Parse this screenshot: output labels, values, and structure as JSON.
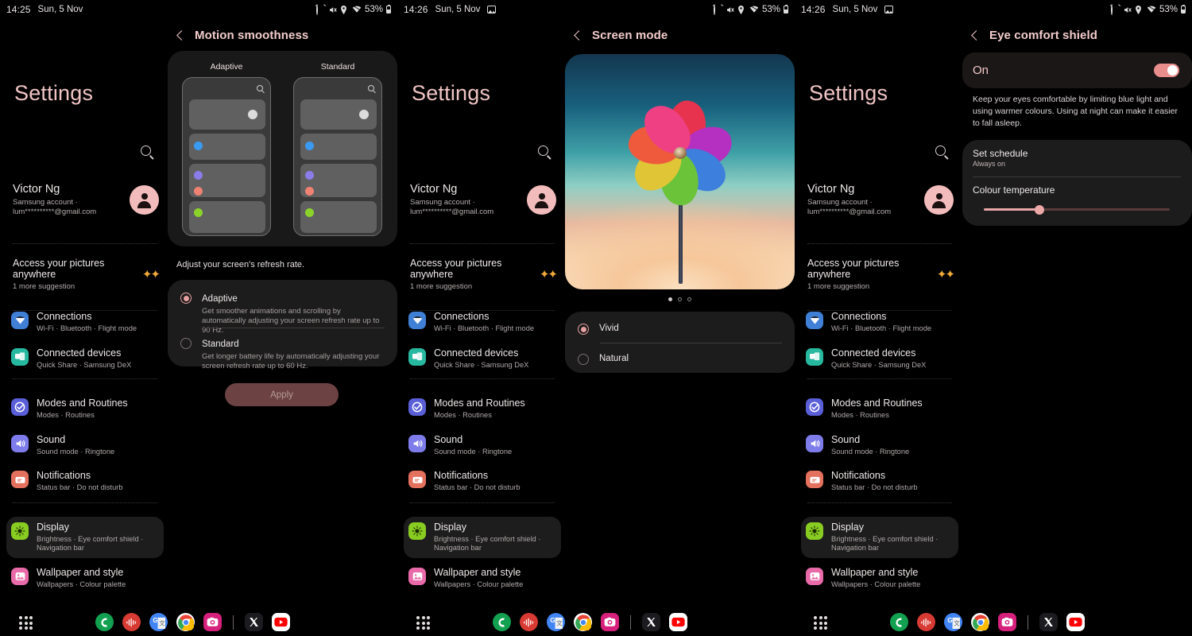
{
  "meta": {
    "accent": "#f0c4c4",
    "selected_row_bg": "#1d1d1d",
    "card_bg": "#1c1c1c"
  },
  "status_bars": [
    {
      "time": "14:25",
      "date": "Sun, 5 Nov",
      "battery": "53%",
      "icons": [
        "alarm-icon",
        "mute-icon",
        "location-icon",
        "wifi-icon",
        "battery-icon"
      ],
      "trailing_icon": ""
    },
    {
      "time": "14:26",
      "date": "Sun, 5 Nov",
      "battery": "53%",
      "icons": [
        "alarm-icon",
        "mute-icon",
        "location-icon",
        "wifi-icon",
        "battery-icon"
      ],
      "trailing_icon": "picture-icon"
    },
    {
      "time": "14:26",
      "date": "Sun, 5 Nov",
      "battery": "53%",
      "icons": [
        "alarm-icon",
        "mute-icon",
        "location-icon",
        "wifi-icon",
        "battery-icon"
      ],
      "trailing_icon": "picture-icon"
    }
  ],
  "settings": {
    "title": "Settings",
    "search_icon": "search-icon",
    "account": {
      "name": "Victor Ng",
      "line1": "Samsung account  ·",
      "line2": "lum**********@gmail.com",
      "avatar": "avatar-icon"
    },
    "suggestion": {
      "title": "Access your pictures anywhere",
      "sub": "1 more suggestion",
      "icon": "sparkle-icon"
    },
    "rows": [
      {
        "label": "Connections",
        "sub": "Wi-Fi  ·  Bluetooth  ·  Flight mode",
        "icon": "wifi-icon",
        "color": "#3f7fd6",
        "selected": false
      },
      {
        "label": "Connected devices",
        "sub": "Quick Share  ·  Samsung DeX",
        "icon": "devices-icon",
        "color": "#27b8a0",
        "selected": false
      },
      {
        "label": "Modes and Routines",
        "sub": "Modes  ·  Routines",
        "icon": "modes-icon",
        "color": "#5a5fd8",
        "selected": false
      },
      {
        "label": "Sound",
        "sub": "Sound mode  ·  Ringtone",
        "icon": "sound-icon",
        "color": "#7d7cea",
        "selected": false
      },
      {
        "label": "Notifications",
        "sub": "Status bar  ·  Do not disturb",
        "icon": "notif-icon",
        "color": "#e4705e",
        "selected": false
      },
      {
        "label": "Display",
        "sub": "Brightness  ·  Eye comfort shield  ·  Navigation bar",
        "icon": "display-icon",
        "color": "#88cc22",
        "selected": true
      },
      {
        "label": "Wallpaper and style",
        "sub": "Wallpapers  ·  Colour palette",
        "icon": "wallpaper-icon",
        "color": "#e86aa8",
        "selected": false
      }
    ]
  },
  "motion_smoothness": {
    "title": "Motion smoothness",
    "back_icon": "back-chevron-icon",
    "preview": {
      "columns": [
        {
          "label": "Adaptive"
        },
        {
          "label": "Standard"
        }
      ],
      "search_icon": "search-icon"
    },
    "caption": "Adjust your screen's refresh rate.",
    "options": [
      {
        "title": "Adaptive",
        "desc": "Get smoother animations and scrolling by automatically adjusting your screen refresh rate up to 90 Hz.",
        "selected": true
      },
      {
        "title": "Standard",
        "desc": "Get longer battery life by automatically adjusting your screen refresh rate up to 60 Hz.",
        "selected": false
      }
    ],
    "apply_label": "Apply"
  },
  "screen_mode": {
    "title": "Screen mode",
    "back_icon": "back-chevron-icon",
    "preview_alt": "pinwheel-wallpaper",
    "page_dots": {
      "count": 3,
      "active_index": 0
    },
    "options": [
      {
        "title": "Vivid",
        "selected": true
      },
      {
        "title": "Natural",
        "selected": false
      }
    ]
  },
  "eye_comfort_shield": {
    "title": "Eye comfort shield",
    "back_icon": "back-chevron-icon",
    "toggle_label": "On",
    "toggle_on": true,
    "description": "Keep your eyes comfortable by limiting blue light and using warmer colours. Using at night can make it easier to fall asleep.",
    "schedule_title": "Set schedule",
    "schedule_value": "Always on",
    "temperature_title": "Colour temperature",
    "temperature_percent": 30
  },
  "taskbar": {
    "apps_button": "app-drawer-icon",
    "apps": [
      {
        "name": "phone-app-icon",
        "label": "C",
        "color": "#12a150",
        "shape": "circle"
      },
      {
        "name": "voice-recorder-icon",
        "label": "",
        "color": "#d83b33",
        "shape": "circle"
      },
      {
        "name": "google-translate-icon",
        "label": "G",
        "color": "#4285f4",
        "shape": "circle"
      },
      {
        "name": "chrome-icon",
        "label": "",
        "color": "#ffffff",
        "shape": "circle"
      },
      {
        "name": "instagram-icon",
        "label": "",
        "color": "#d6207c",
        "shape": "square"
      },
      {
        "name": "separator",
        "label": "",
        "color": "",
        "shape": "sep"
      },
      {
        "name": "x-twitter-icon",
        "label": "X",
        "color": "#1c1c20",
        "shape": "square"
      },
      {
        "name": "youtube-icon",
        "label": "",
        "color": "#ffffff",
        "shape": "square"
      }
    ]
  }
}
